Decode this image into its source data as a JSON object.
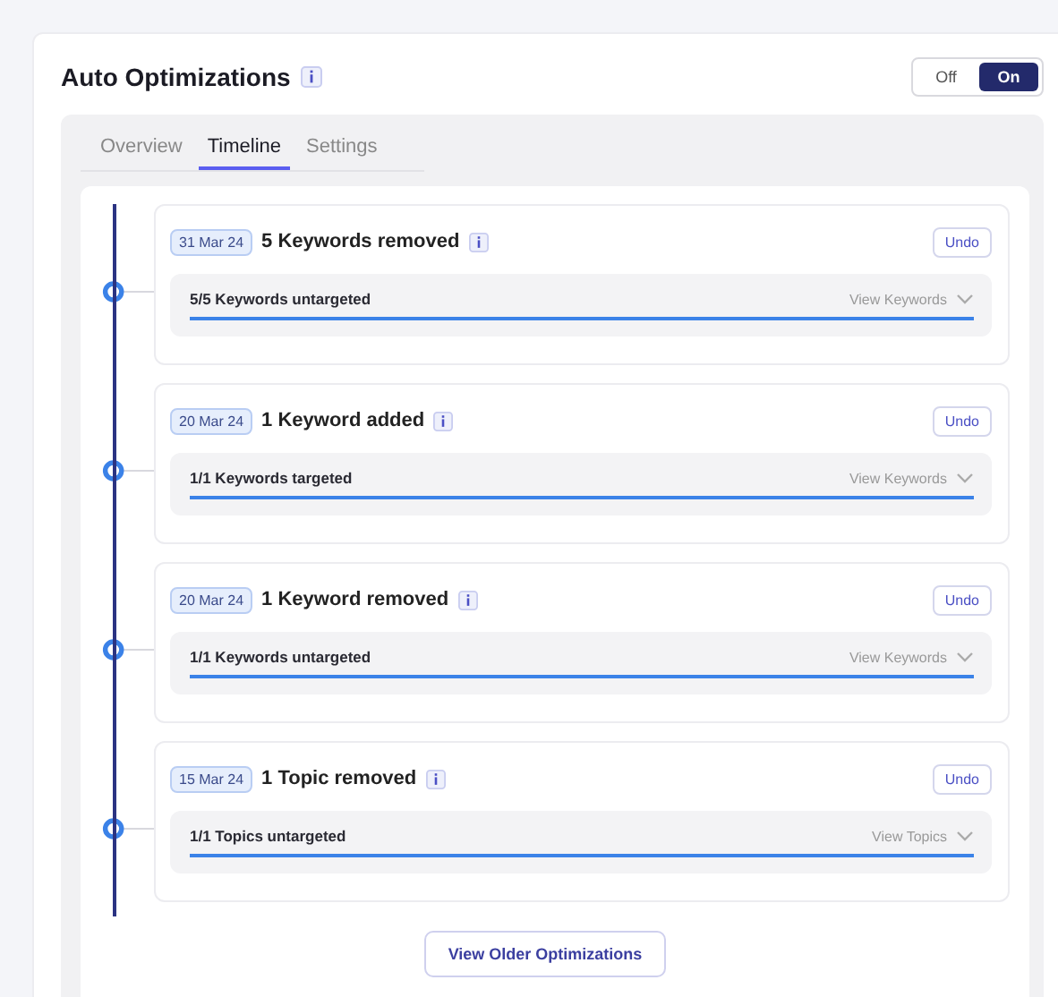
{
  "title": "Auto Optimizations",
  "toggle": [
    {
      "label": "Off",
      "selected": false
    },
    {
      "label": "On",
      "selected": true
    }
  ],
  "tabs": [
    {
      "label": "Overview",
      "selected": false
    },
    {
      "label": "Timeline",
      "selected": true
    },
    {
      "label": "Settings",
      "selected": false
    }
  ],
  "entries": [
    {
      "date": "31 Mar 24",
      "title": "5 Keywords removed",
      "undo": "Undo",
      "summary": "5/5 Keywords untargeted",
      "view": "View Keywords",
      "level": 1
    },
    {
      "date": "20 Mar 24",
      "title": "1 Keyword added",
      "undo": "Undo",
      "summary": "1/1 Keywords targeted",
      "view": "View Keywords",
      "level": 1
    },
    {
      "date": "20 Mar 24",
      "title": "1 Keyword removed",
      "undo": "Undo",
      "summary": "1/1 Keywords untargeted",
      "view": "View Keywords",
      "level": 1
    },
    {
      "date": "15 Mar 24",
      "title": "1 Topic removed",
      "undo": "Undo",
      "summary": "1/1 Topics untargeted",
      "view": "View Topics",
      "level": 1
    }
  ],
  "older_button": "View Older Optimizations"
}
